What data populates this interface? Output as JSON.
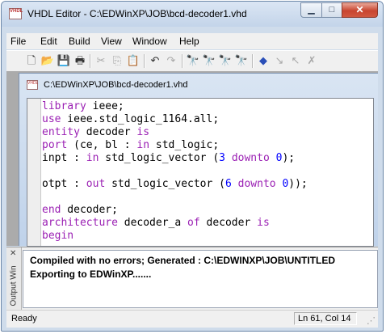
{
  "window": {
    "title": "VHDL Editor - C:\\EDWinXP\\JOB\\bcd-decoder1.vhd",
    "app_icon_text": "VHDL",
    "minimize_glyph": "▁",
    "maximize_glyph": "□",
    "close_glyph": "✕"
  },
  "menu": [
    "File",
    "Edit",
    "Build",
    "View",
    "Window",
    "Help"
  ],
  "toolbar": {
    "buttons": [
      {
        "icon": "new-file-icon",
        "glyph": "🗋"
      },
      {
        "icon": "open-folder-icon",
        "glyph": "📂"
      },
      {
        "icon": "save-icon",
        "glyph": "💾"
      },
      {
        "icon": "print-icon",
        "glyph": "🖶"
      },
      {
        "icon": "cut-icon",
        "glyph": "✂"
      },
      {
        "icon": "copy-icon",
        "glyph": "⎘"
      },
      {
        "icon": "paste-icon",
        "glyph": "📋"
      },
      {
        "icon": "undo-icon",
        "glyph": "↶"
      },
      {
        "icon": "redo-icon",
        "glyph": "↷"
      },
      {
        "icon": "find-icon",
        "glyph": "🔭"
      },
      {
        "icon": "find-next-icon",
        "glyph": "🔭"
      },
      {
        "icon": "replace-icon",
        "glyph": "🔭"
      },
      {
        "icon": "find-in-files-icon",
        "glyph": "🔭"
      },
      {
        "icon": "toggle-bookmark-icon",
        "glyph": "◆"
      },
      {
        "icon": "next-bookmark-icon",
        "glyph": "↘"
      },
      {
        "icon": "previous-bookmark-icon",
        "glyph": "↖"
      },
      {
        "icon": "clear-bookmarks-icon",
        "glyph": "✗"
      }
    ]
  },
  "document": {
    "title": "C:\\EDWinXP\\JOB\\bcd-decoder1.vhd",
    "icon_text": "VHDL",
    "lines": [
      [
        {
          "t": "library",
          "c": "kw"
        },
        {
          "t": " ieee;"
        }
      ],
      [
        {
          "t": "use",
          "c": "kw"
        },
        {
          "t": " ieee.std_logic_1164.all;"
        }
      ],
      [
        {
          "t": "entity",
          "c": "kw"
        },
        {
          "t": " decoder "
        },
        {
          "t": "is",
          "c": "kw"
        }
      ],
      [
        {
          "t": "port",
          "c": "kw"
        },
        {
          "t": " (ce, bl : "
        },
        {
          "t": "in",
          "c": "kw"
        },
        {
          "t": " std_logic;"
        }
      ],
      [
        {
          "t": "inpt : "
        },
        {
          "t": "in",
          "c": "kw"
        },
        {
          "t": " std_logic_vector ("
        },
        {
          "t": "3",
          "c": "num"
        },
        {
          "t": " "
        },
        {
          "t": "downto",
          "c": "kw"
        },
        {
          "t": " "
        },
        {
          "t": "0",
          "c": "num"
        },
        {
          "t": ");"
        }
      ],
      [],
      [
        {
          "t": "otpt : "
        },
        {
          "t": "out",
          "c": "kw"
        },
        {
          "t": " std_logic_vector ("
        },
        {
          "t": "6",
          "c": "num"
        },
        {
          "t": " "
        },
        {
          "t": "downto",
          "c": "kw"
        },
        {
          "t": " "
        },
        {
          "t": "0",
          "c": "num"
        },
        {
          "t": "));"
        }
      ],
      [],
      [
        {
          "t": "end",
          "c": "kw"
        },
        {
          "t": " decoder;"
        }
      ],
      [
        {
          "t": "architecture",
          "c": "kw"
        },
        {
          "t": " decoder_a "
        },
        {
          "t": "of",
          "c": "kw"
        },
        {
          "t": " decoder "
        },
        {
          "t": "is",
          "c": "kw"
        }
      ],
      [
        {
          "t": "begin",
          "c": "kw"
        }
      ]
    ]
  },
  "output": {
    "label": "Output Win",
    "close_glyph": "✕",
    "lines": [
      "Compiled with no errors; Generated : C:\\EDWINXP\\JOB\\UNTITLED",
      "Exporting to EDWinXP......."
    ]
  },
  "status": {
    "text": "Ready",
    "position": "Ln 61, Col 14"
  },
  "colors": {
    "keyword": "#9b21b4",
    "number": "#0000ff"
  }
}
